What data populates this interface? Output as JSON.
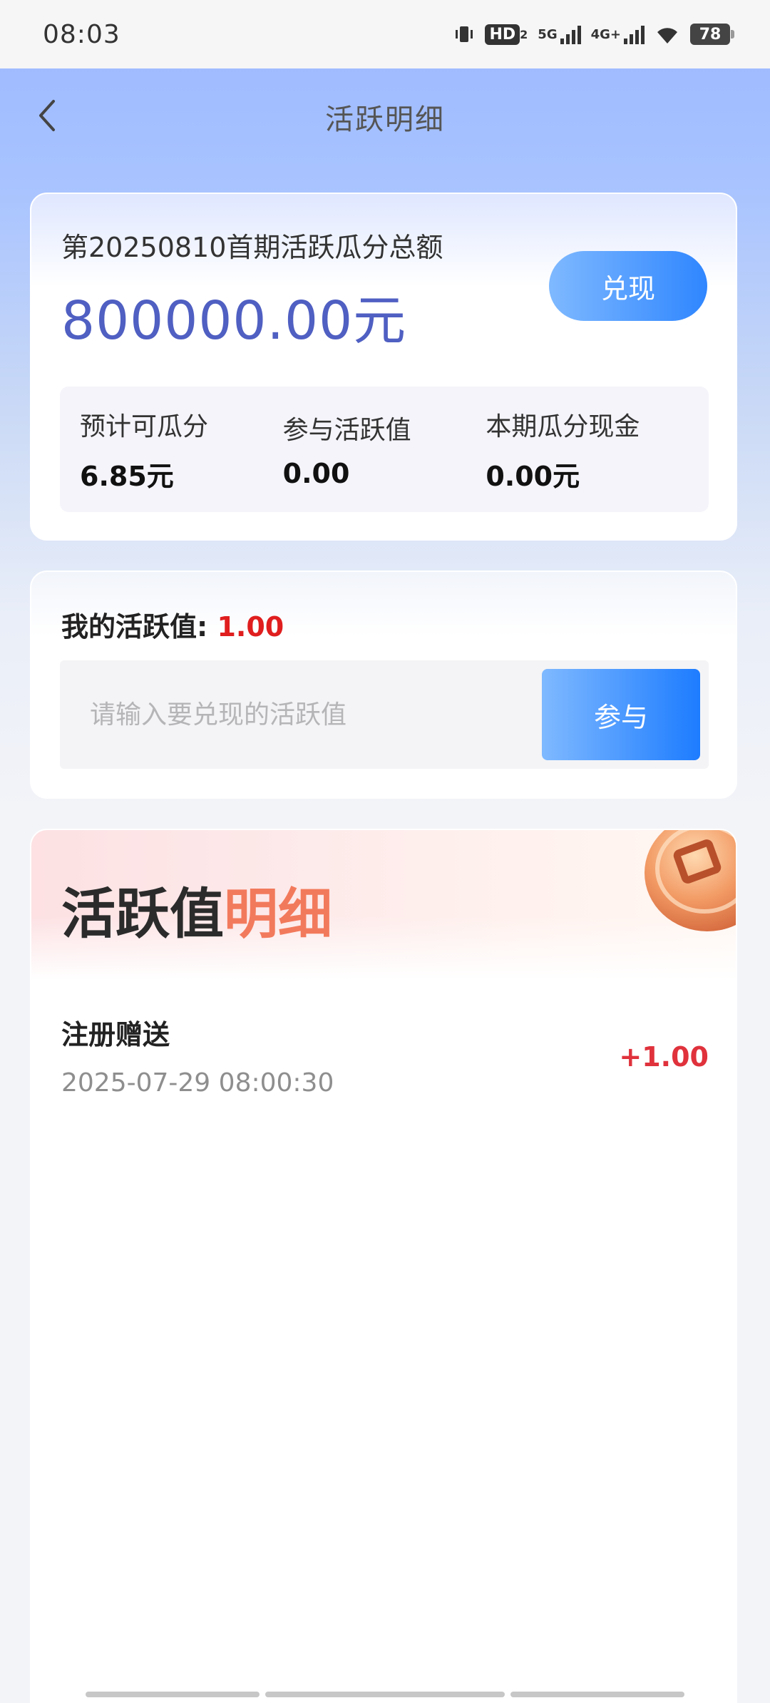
{
  "status_bar": {
    "time": "08:03",
    "hd_label": "HD",
    "hd_sub": "2",
    "net_5g": "5G",
    "net_4g": "4G+",
    "battery": "78"
  },
  "nav": {
    "title": "活跃明细",
    "back_icon": "chevron-left-icon"
  },
  "pool": {
    "label": "第20250810首期活跃瓜分总额",
    "amount": "800000.00元",
    "redeem_label": "兑现",
    "stats": [
      {
        "label": "预计可瓜分",
        "value": "6.85元"
      },
      {
        "label": "参与活跃值",
        "value": "0.00"
      },
      {
        "label": "本期瓜分现金",
        "value": "0.00元"
      }
    ]
  },
  "my_active": {
    "label": "我的活跃值:",
    "value": "1.00",
    "input_placeholder": "请输入要兑现的活跃值",
    "join_label": "参与"
  },
  "details": {
    "title_part1": "活跃值",
    "title_part2": "明细",
    "records": [
      {
        "title": "注册赠送",
        "time": "2025-07-29 08:00:30",
        "amount": "+1.00"
      }
    ]
  },
  "colors": {
    "accent_blue": "#2f86ff",
    "amount_blue": "#4f5fc2",
    "red": "#e01e1e",
    "orange": "#f27a5c"
  }
}
